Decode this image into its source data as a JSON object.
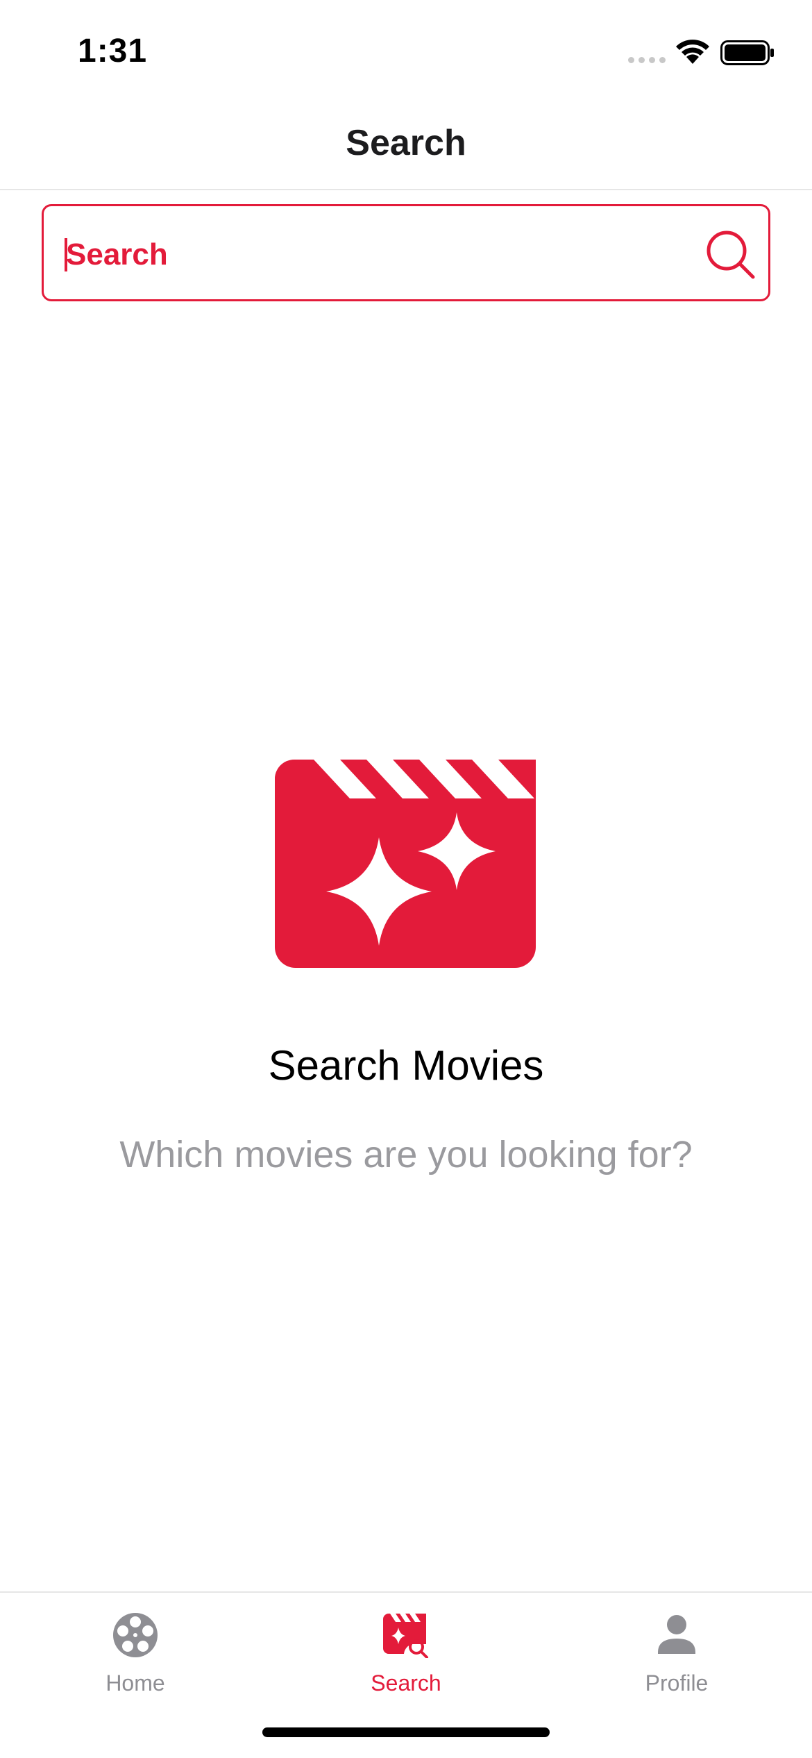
{
  "status_bar": {
    "time": "1:31",
    "icons": [
      "signal-icon",
      "wifi-icon",
      "battery-icon"
    ]
  },
  "header": {
    "title": "Search"
  },
  "search": {
    "placeholder": "Search",
    "value": "",
    "icon": "search-icon"
  },
  "empty_state": {
    "icon": "clapperboard-sparkle-icon",
    "title": "Search Movies",
    "subtitle": "Which movies are you looking for?"
  },
  "tab_bar": {
    "items": [
      {
        "label": "Home",
        "icon": "film-reel-icon",
        "active": false
      },
      {
        "label": "Search",
        "icon": "clapperboard-search-icon",
        "active": true
      },
      {
        "label": "Profile",
        "icon": "person-icon",
        "active": false
      }
    ]
  },
  "colors": {
    "accent": "#e31b3a",
    "inactive": "#8e8e93",
    "subtitle": "#9a9a9e",
    "divider": "#e6e6e6"
  }
}
